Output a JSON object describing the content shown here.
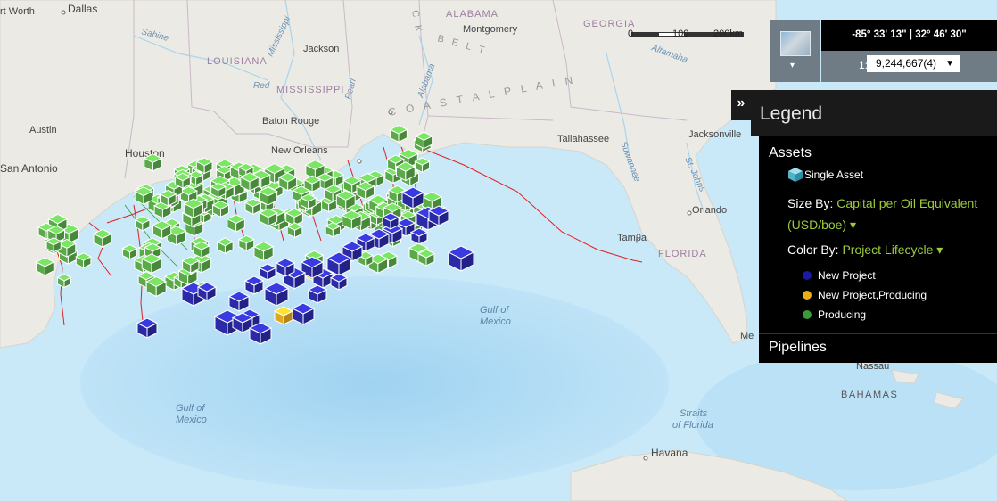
{
  "map": {
    "place_labels": [
      {
        "text": "Dallas",
        "type": "city"
      },
      {
        "text": "rt Worth",
        "type": "city"
      },
      {
        "text": "Sabine",
        "type": "water"
      },
      {
        "text": "LOUISIANA",
        "type": "state"
      },
      {
        "text": "Mississippi",
        "type": "water"
      },
      {
        "text": "Red",
        "type": "water"
      },
      {
        "text": "Jackson",
        "type": "city"
      },
      {
        "text": "MISSISSIPPI",
        "type": "state"
      },
      {
        "text": "Pearl",
        "type": "water"
      },
      {
        "text": "Baton Rouge",
        "type": "city"
      },
      {
        "text": "New Orleans",
        "type": "city"
      },
      {
        "text": "Austin",
        "type": "city"
      },
      {
        "text": "Houston",
        "type": "city"
      },
      {
        "text": "San Antonio",
        "type": "city"
      },
      {
        "text": "ALABAMA",
        "type": "state"
      },
      {
        "text": "Montgomery",
        "type": "city"
      },
      {
        "text": "B E L T",
        "type": "region"
      },
      {
        "text": "C K",
        "type": "region"
      },
      {
        "text": "Alabama",
        "type": "water"
      },
      {
        "text": "C O A S T A L   P L A I N",
        "type": "region"
      },
      {
        "text": "GEORGIA",
        "type": "state"
      },
      {
        "text": "Altamaha",
        "type": "water"
      },
      {
        "text": "Tallahassee",
        "type": "city"
      },
      {
        "text": "Suwannee",
        "type": "water"
      },
      {
        "text": "Jacksonville",
        "type": "city"
      },
      {
        "text": "St. Johns",
        "type": "water"
      },
      {
        "text": "Orlando",
        "type": "city"
      },
      {
        "text": "Tampa",
        "type": "city"
      },
      {
        "text": "FLORIDA",
        "type": "state"
      },
      {
        "text": "Gulf of",
        "type": "ocean"
      },
      {
        "text": "Mexico",
        "type": "ocean"
      },
      {
        "text": "Gulf of",
        "type": "ocean"
      },
      {
        "text": "Mexico",
        "type": "ocean"
      },
      {
        "text": "Straits",
        "type": "ocean"
      },
      {
        "text": "of Florida",
        "type": "ocean"
      },
      {
        "text": "Havana",
        "type": "city"
      },
      {
        "text": "Nassau",
        "type": "city"
      },
      {
        "text": "BAHAMAS",
        "type": "country"
      },
      {
        "text": "Me",
        "type": "city"
      }
    ]
  },
  "scalebar": {
    "ticks": [
      "0",
      "100",
      "200km"
    ]
  },
  "basemap": {
    "icon": "basemap-thumbnail-icon",
    "caret": "▾"
  },
  "coordinates": {
    "text": "-85° 33' 13\" | 32° 46' 30\""
  },
  "scale": {
    "prefix": "1:",
    "value": "9,244,667(4)",
    "caret": "▼"
  },
  "legend": {
    "toggle": "»",
    "title": "Legend",
    "assets_heading": "Assets",
    "single_asset": "Single Asset",
    "size_by_label": "Size By:",
    "size_by_value": "Capital per Oil Equivalent (USD/boe) ▾",
    "color_by_label": "Color By:",
    "color_by_value": "Project Lifecycle ▾",
    "categories": [
      {
        "label": "New Project",
        "color": "#1a1aa6"
      },
      {
        "label": "New Project,Producing",
        "color": "#e8b012"
      },
      {
        "label": "Producing",
        "color": "#3a9a3a"
      }
    ],
    "pipelines_heading": "Pipelines"
  },
  "colors": {
    "new_project": "#2b2ba8",
    "new_project_producing": "#e0a820",
    "producing": "#5aaa4a",
    "pipeline": "#e02020",
    "water": "#cfe9f7",
    "land": "#eceae4"
  }
}
